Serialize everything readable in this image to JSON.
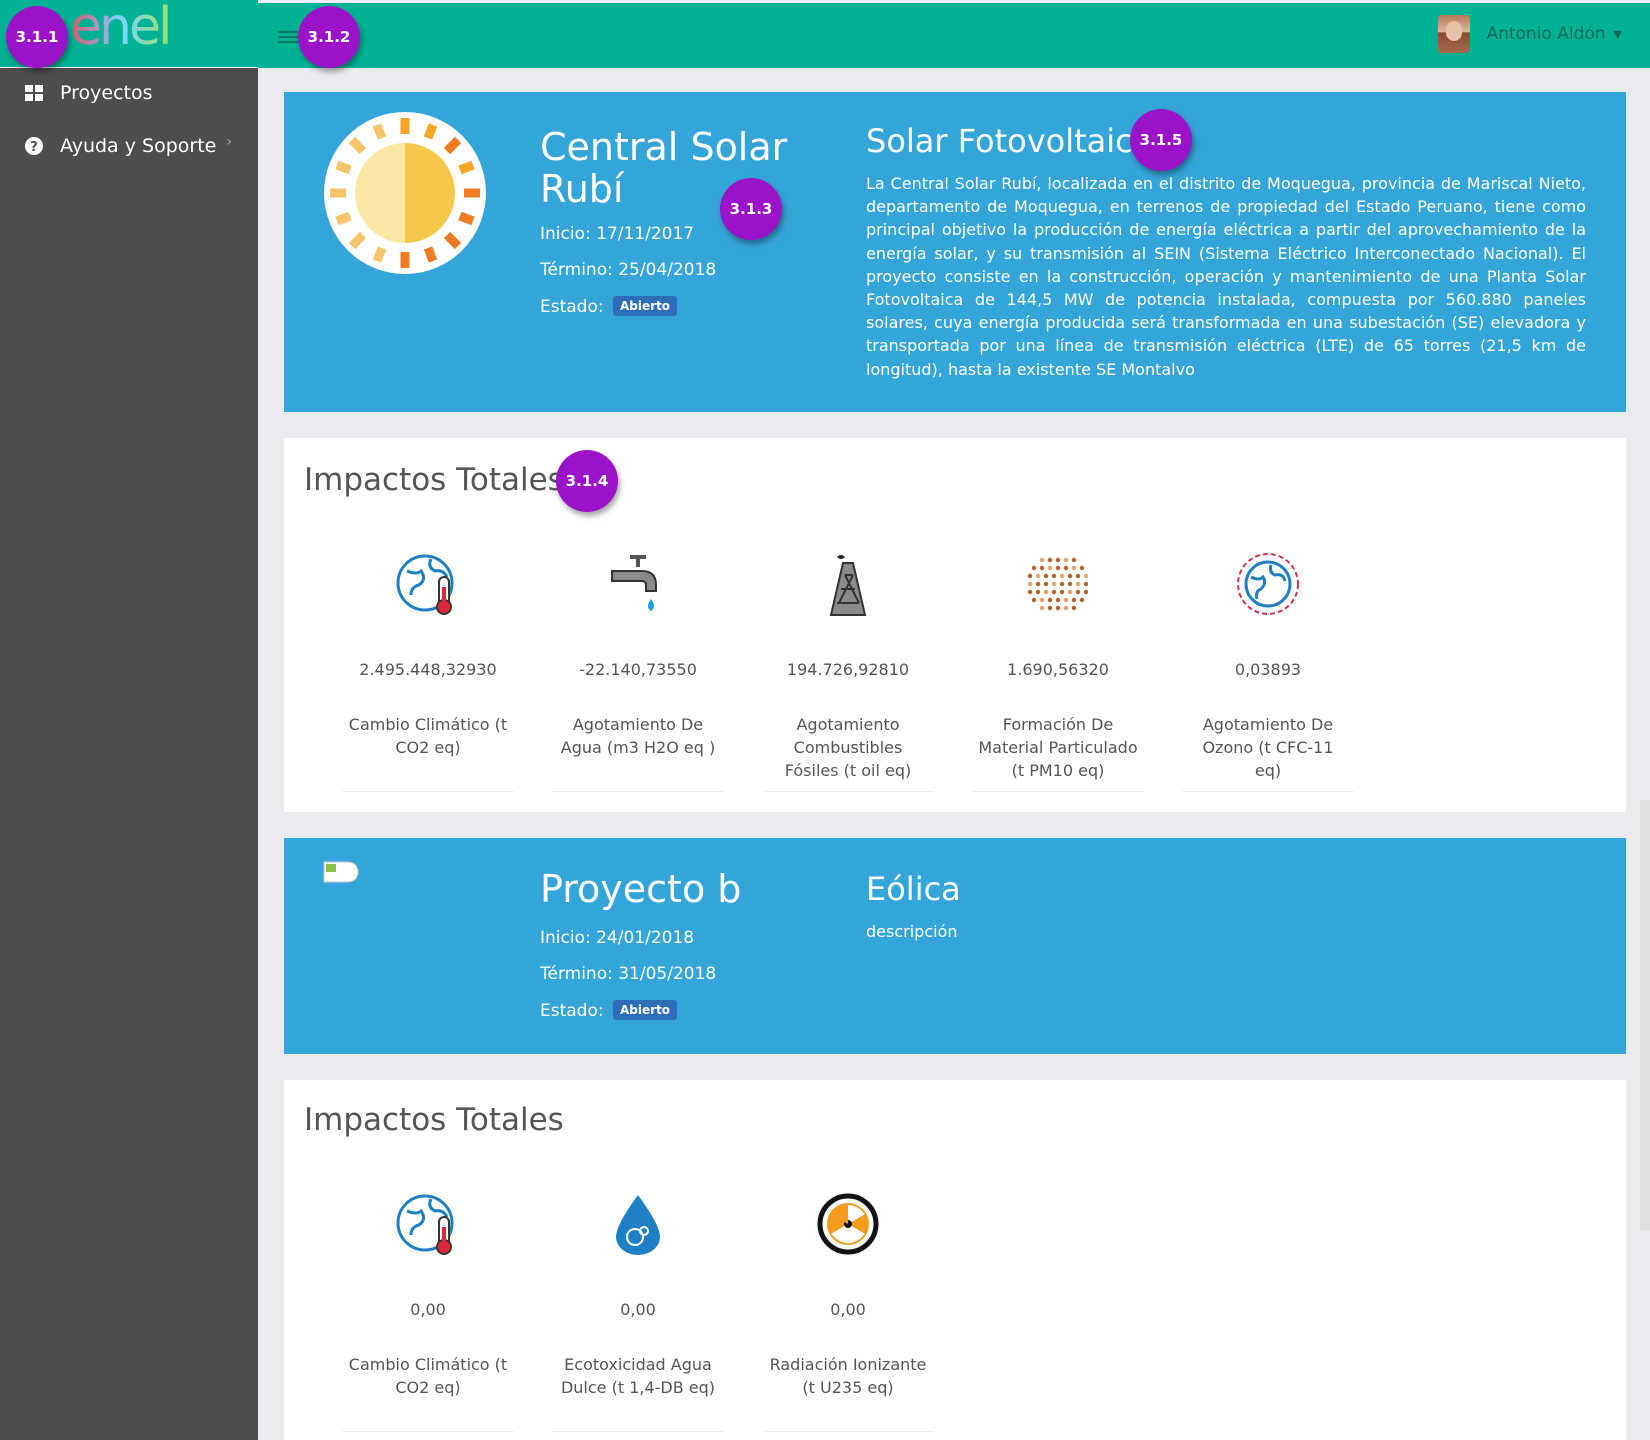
{
  "sidebar": {
    "logo": "enel",
    "items": [
      {
        "label": "Proyectos",
        "icon": "grid-icon"
      },
      {
        "label": "Ayuda y Soporte",
        "icon": "help-circle-icon"
      }
    ]
  },
  "topbar": {
    "user_name": "Antonio Aldón"
  },
  "markers": [
    "3.1.1",
    "3.1.2",
    "3.1.3",
    "3.1.4",
    "3.1.5"
  ],
  "projects": [
    {
      "name": "Central Solar Rubí",
      "start": "Inicio: 17/11/2017",
      "end": "Término: 25/04/2018",
      "status_label": "Estado:",
      "status": "Abierto",
      "type": "Solar Fotovoltaica",
      "description": "La Central Solar Rubí, localizada en el distrito de Moquegua, provincia de Mariscal Nieto, departamento de Moquegua, en terrenos de propiedad del Estado Peruano, tiene como principal objetivo la producción de energía eléctrica a partir del aprovechamiento de la energía solar, y su transmisión al SEIN (Sistema Eléctrico Interconectado Nacional). El proyecto consiste en la construcción, operación y mantenimiento de una Planta Solar Fotovoltaica de 144,5 MW de potencia instalada, compuesta por 560.880 paneles solares, cuya energía producida será transformada en una subestación (SE) elevadora y transportada por una línea de transmisión eléctrica (LTE) de 65 torres (21,5 km de longitud), hasta la existente SE Montalvo",
      "impacts_title": "Impactos Totales",
      "impacts": [
        {
          "icon": "globe-thermometer-icon",
          "value": "2.495.448,32930",
          "label": "Cambio Climático (t CO2 eq)"
        },
        {
          "icon": "water-tap-icon",
          "value": "-22.140,73550",
          "label": "Agotamiento De Agua (m3 H2O eq )"
        },
        {
          "icon": "oil-derrick-icon",
          "value": "194.726,92810",
          "label": "Agotamiento Combustibles Fósiles (t oil eq)"
        },
        {
          "icon": "particulate-dots-icon",
          "value": "1.690,56320",
          "label": "Formación De Material Particulado (t PM10 eq)"
        },
        {
          "icon": "ozone-globe-icon",
          "value": "0,03893",
          "label": "Agotamiento De Ozono (t CFC-11 eq)"
        }
      ]
    },
    {
      "name": "Proyecto b",
      "start": "Inicio: 24/01/2018",
      "end": "Término: 31/05/2018",
      "status_label": "Estado:",
      "status": "Abierto",
      "type": "Eólica",
      "description": "descripción",
      "impacts_title": "Impactos Totales",
      "impacts": [
        {
          "icon": "globe-thermometer-icon",
          "value": "0,00",
          "label": "Cambio Climático (t CO2 eq)"
        },
        {
          "icon": "water-drop-bacteria-icon",
          "value": "0,00",
          "label": "Ecotoxicidad Agua Dulce (t 1,4-DB eq)"
        },
        {
          "icon": "radiation-icon",
          "value": "0,00",
          "label": "Radiación Ionizante (t U235 eq)"
        }
      ]
    }
  ],
  "colors": {
    "topbar": "#00b294",
    "sidebar": "#4d4d4d",
    "banner": "#34a5d8",
    "marker": "#9c12c8",
    "badge": "#2c6fb8"
  }
}
